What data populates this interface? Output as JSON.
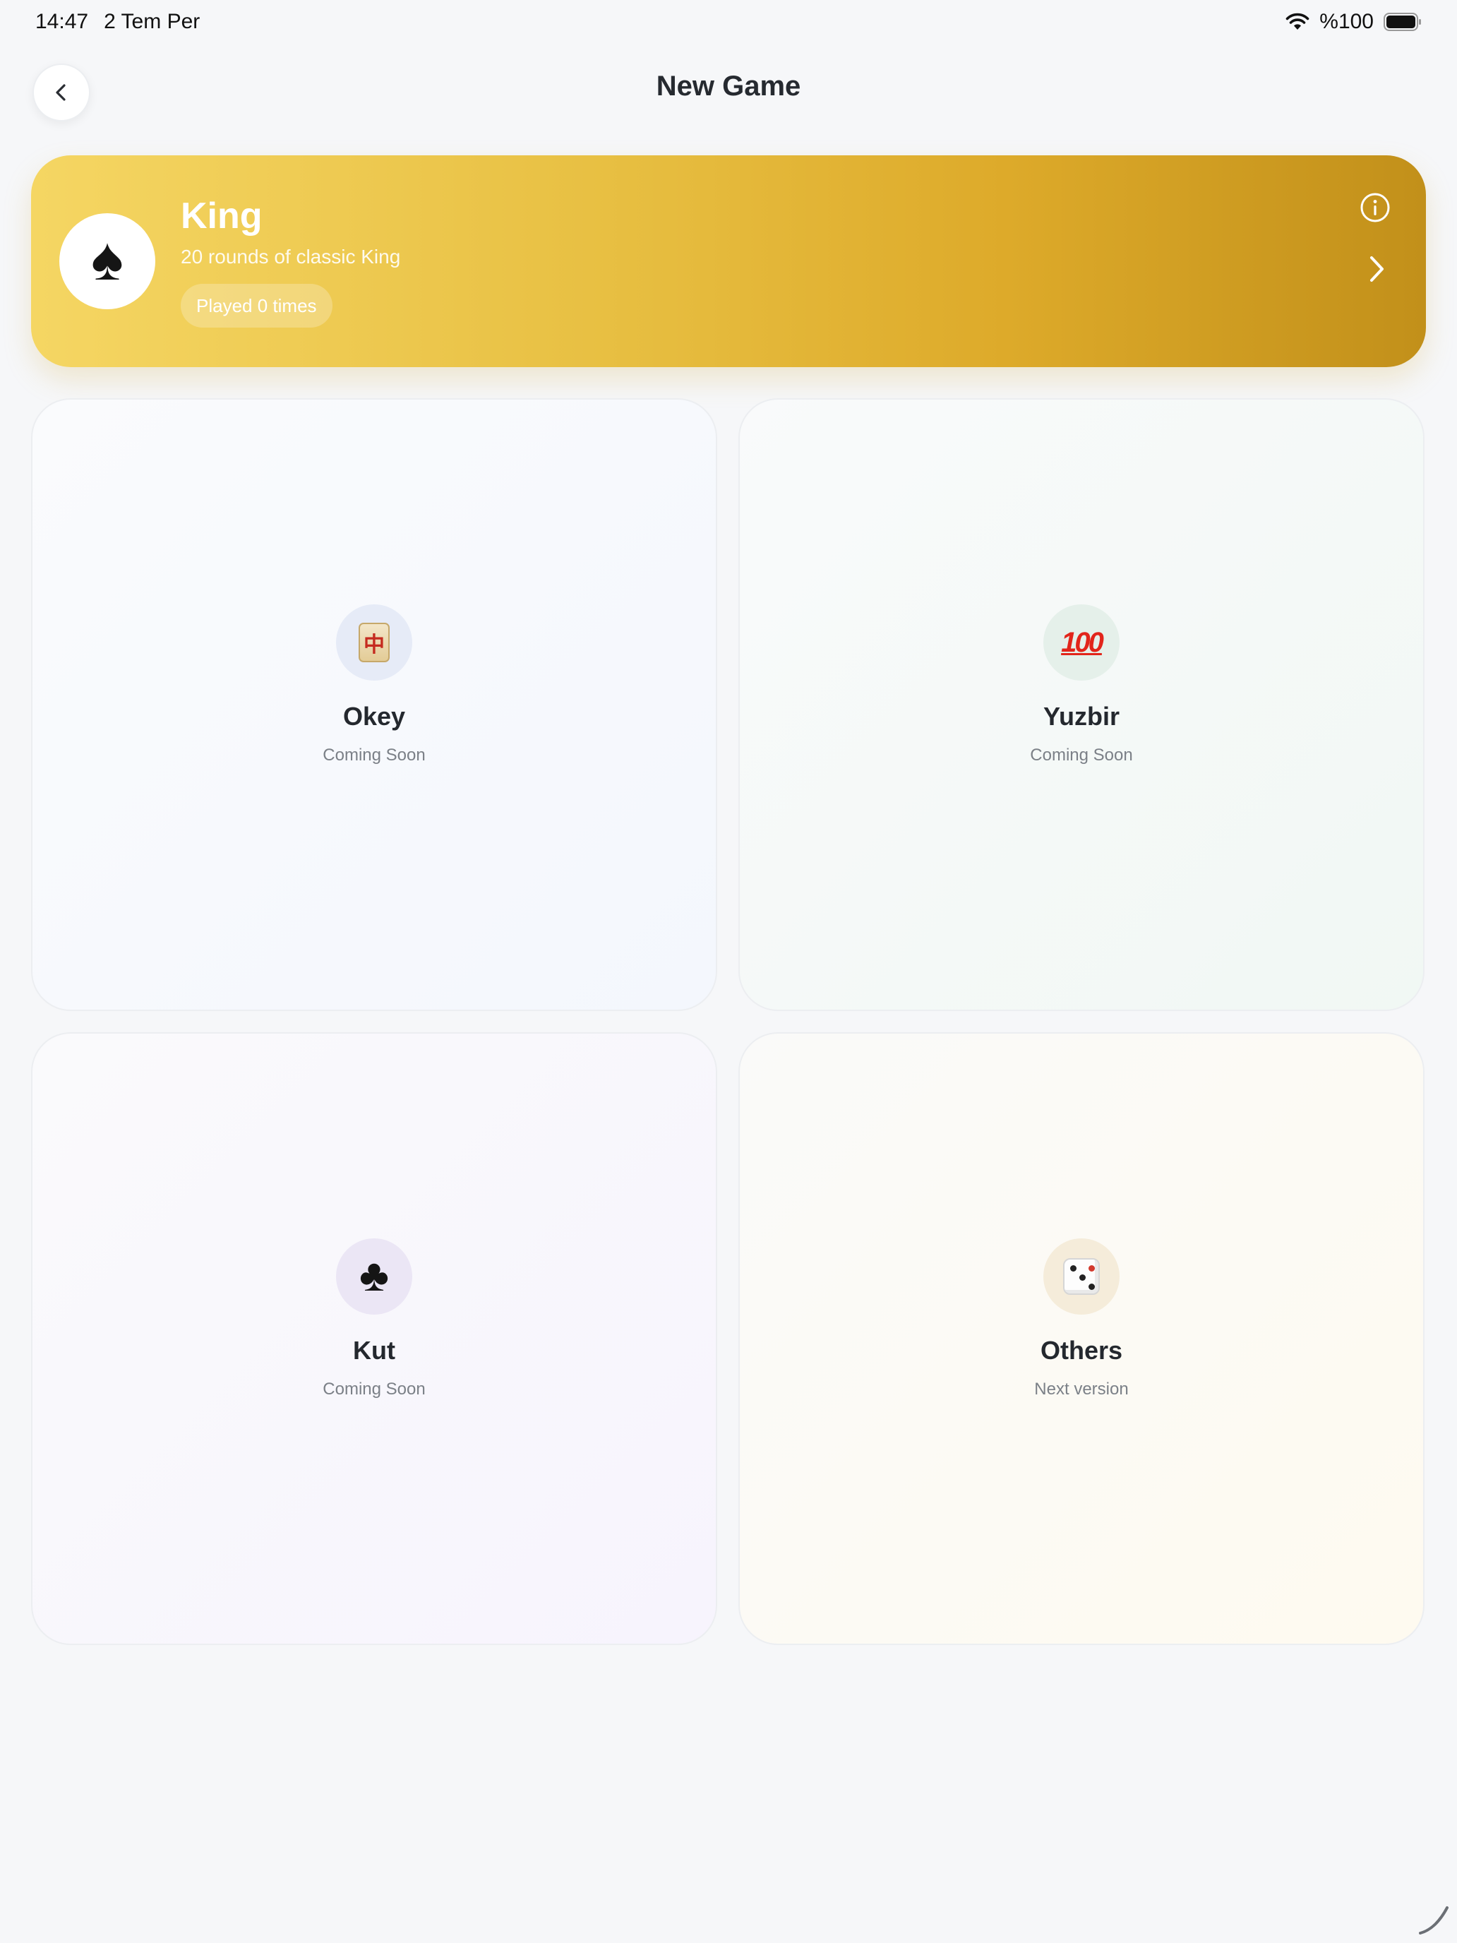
{
  "status_bar": {
    "time": "14:47",
    "date": "2 Tem Per",
    "battery": "%100"
  },
  "header": {
    "title": "New Game",
    "back_icon": "chevron-left-icon"
  },
  "featured": {
    "icon": "♠",
    "title": "King",
    "subtitle": "20 rounds of classic King",
    "badge": "Played 0 times",
    "accent_from": "#f5d663",
    "accent_to": "#c2901a"
  },
  "games": [
    {
      "name": "Okey",
      "status": "Coming Soon",
      "icon": "mahjong-tile-icon",
      "icon_bg": "#e6ebf7"
    },
    {
      "name": "Yuzbir",
      "status": "Coming Soon",
      "icon": "hundred-points-icon",
      "icon_bg": "#e5f0ea"
    },
    {
      "name": "Kut",
      "status": "Coming Soon",
      "icon": "club-suit-icon",
      "icon_bg": "#ebe6f5"
    },
    {
      "name": "Others",
      "status": "Next version",
      "icon": "dice-icon",
      "icon_bg": "#f5ecda"
    }
  ],
  "glyphs": {
    "tile": "中",
    "hundred": "100",
    "club": "♣"
  }
}
